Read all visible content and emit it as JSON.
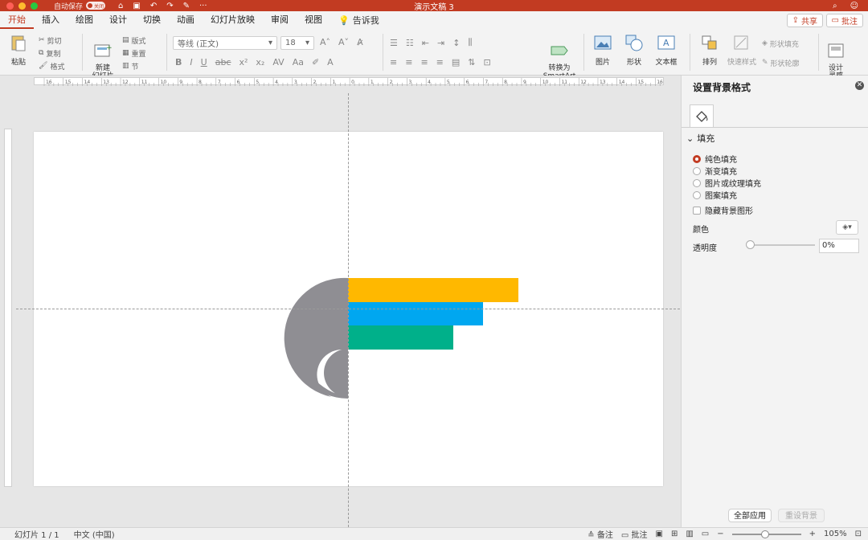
{
  "titlebar": {
    "autosave_label": "自动保存",
    "autosave_state": "关闭",
    "doc_title": "演示文稿 3"
  },
  "tabs": [
    "开始",
    "插入",
    "绘图",
    "设计",
    "切换",
    "动画",
    "幻灯片放映",
    "审阅",
    "视图"
  ],
  "tell_me": "告诉我",
  "share": "共享",
  "comments": "批注",
  "ribbon": {
    "paste": "粘贴",
    "cut": "剪切",
    "copy": "复制",
    "format": "格式",
    "new_slide": "新建\n幻灯片",
    "layout": "版式",
    "reset": "重置",
    "section": "节",
    "font_name": "等线 (正文)",
    "font_size": "18",
    "convert_smartart": "转换为\nSmartArt",
    "picture": "图片",
    "shapes": "形状",
    "textbox": "文本框",
    "arrange": "排列",
    "quick_styles": "快速样式",
    "shape_fill": "形状填充",
    "shape_outline": "形状轮廓",
    "design_ideas": "设计\n灵感"
  },
  "ruler_labels_h": [
    "16",
    "15",
    "14",
    "13",
    "12",
    "11",
    "10",
    "9",
    "8",
    "7",
    "6",
    "5",
    "4",
    "3",
    "2",
    "1",
    "0",
    "1",
    "2",
    "3",
    "4",
    "5",
    "6",
    "7",
    "8",
    "9",
    "10",
    "11",
    "12",
    "13",
    "14",
    "15",
    "16"
  ],
  "slide_shapes": {
    "colors": {
      "gray": "#8f8e93",
      "yellow": "#ffb800",
      "blue": "#00a7f0",
      "green": "#00b08a"
    }
  },
  "pane": {
    "title": "设置背景格式",
    "section": "填充",
    "options": [
      "纯色填充",
      "渐变填充",
      "图片或纹理填充",
      "图案填充"
    ],
    "selected_option": "纯色填充",
    "hide_bg_graphics": "隐藏背景图形",
    "color_label": "颜色",
    "transparency_label": "透明度",
    "transparency_value": "0%",
    "apply_all": "全部应用",
    "reset_bg": "重设背景"
  },
  "status": {
    "slide_info": "幻灯片 1 / 1",
    "language": "中文 (中国)",
    "notes": "备注",
    "comments": "批注",
    "zoom": "105%"
  },
  "accent_color": "#c23b22"
}
